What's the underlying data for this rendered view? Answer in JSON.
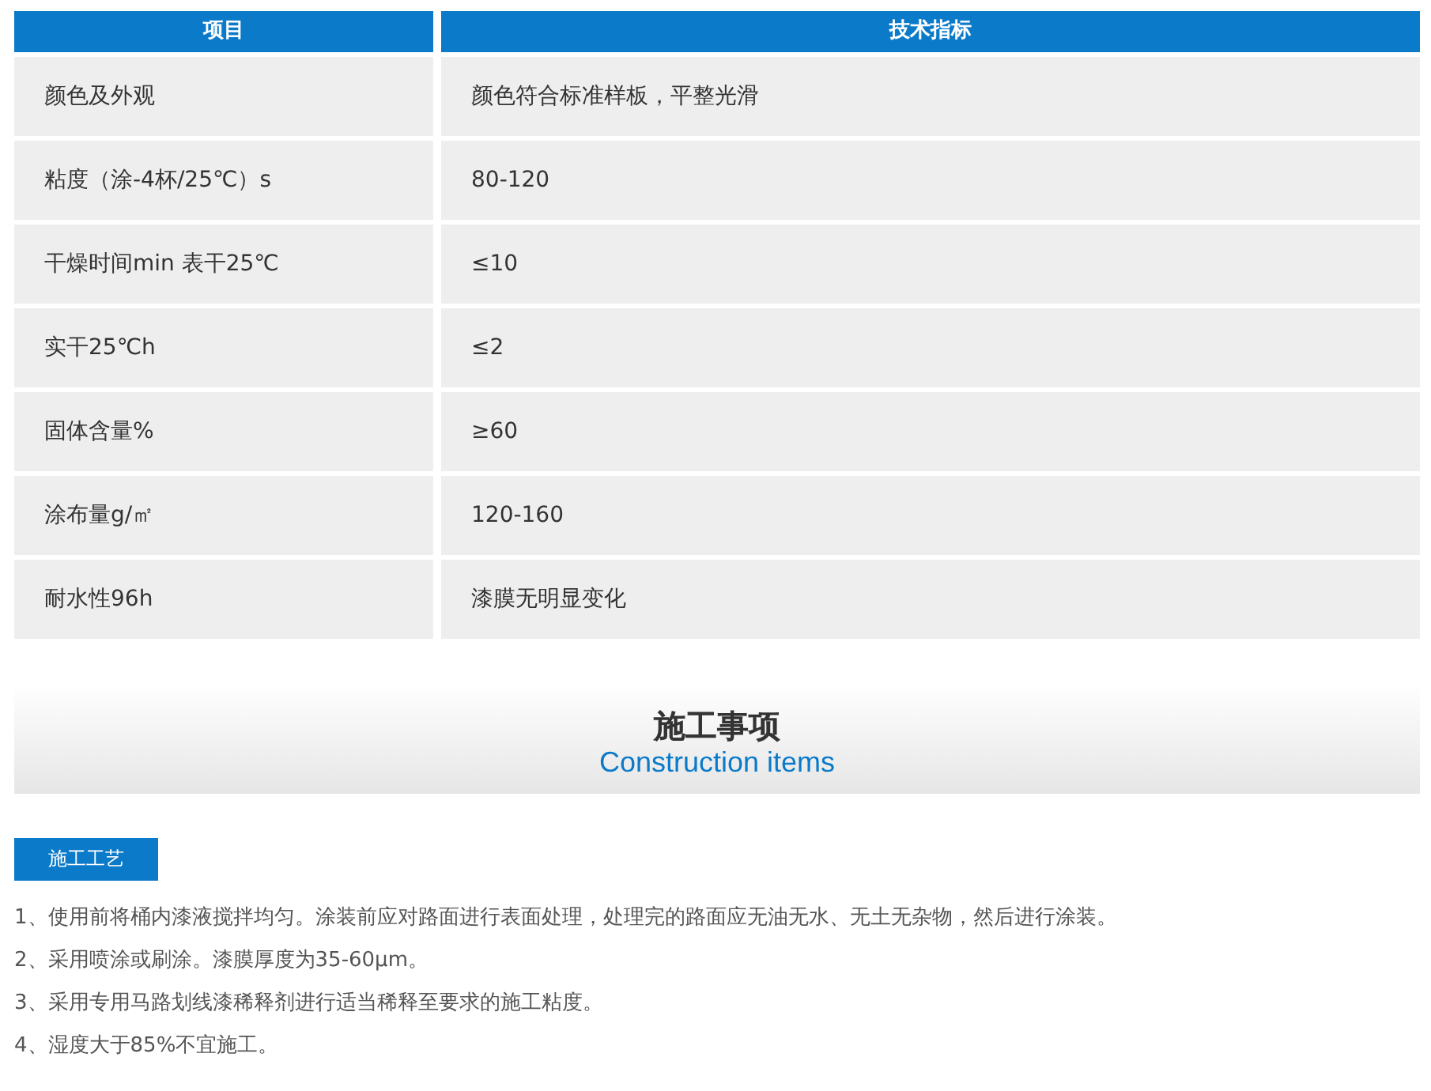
{
  "table": {
    "columns": [
      "项目",
      "技术指标"
    ],
    "rows": [
      [
        "颜色及外观",
        "颜色符合标准样板，平整光滑"
      ],
      [
        "粘度（涂-4杯/25℃）s",
        "80-120"
      ],
      [
        "干燥时间min 表干25℃",
        "≤10"
      ],
      [
        "实干25℃h",
        "≤2"
      ],
      [
        "固体含量%",
        "≥60"
      ],
      [
        "涂布量g/㎡",
        "120-160"
      ],
      [
        "耐水性96h",
        "漆膜无明显变化"
      ]
    ]
  },
  "section": {
    "title": "施工事项",
    "subtitle": "Construction items"
  },
  "tag": "施工工艺",
  "steps": [
    "1、使用前将桶内漆液搅拌均匀。涂装前应对路面进行表面处理，处理完的路面应无油无水、无土无杂物，然后进行涂装。",
    "2、采用喷涂或刷涂。漆膜厚度为35-60μm。",
    "3、采用专用马路划线漆稀释剂进行适当稀释至要求的施工粘度。",
    "4、湿度大于85%不宜施工。"
  ]
}
